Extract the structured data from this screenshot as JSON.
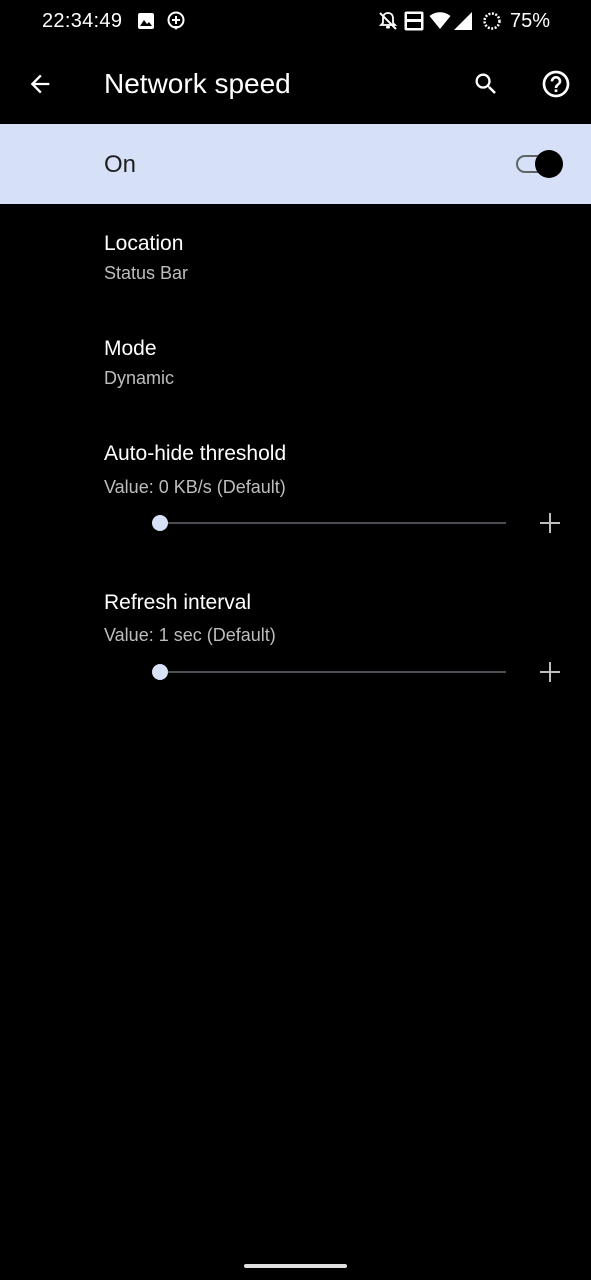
{
  "status_bar": {
    "time": "22:34:49",
    "battery_percent": "75%",
    "left_icons": [
      "image-icon",
      "location-plus-icon"
    ],
    "right_icons": [
      "notifications-off-icon",
      "volte-icon",
      "wifi-icon",
      "signal-icon",
      "battery-saver-ring-icon"
    ]
  },
  "app_bar": {
    "title": "Network speed",
    "back_icon": "arrow-back-icon",
    "actions": [
      "search-icon",
      "help-icon"
    ]
  },
  "master_switch": {
    "label": "On",
    "checked": true,
    "background": "#d6e0f7"
  },
  "preferences": {
    "location": {
      "title": "Location",
      "summary": "Status Bar"
    },
    "mode": {
      "title": "Mode",
      "summary": "Dynamic"
    },
    "auto_hide": {
      "title": "Auto-hide threshold",
      "summary": "Value: 0 KB/s (Default)",
      "slider_fraction": 0
    },
    "refresh": {
      "title": "Refresh interval",
      "summary": "Value: 1 sec (Default)",
      "slider_fraction": 0
    }
  },
  "colors": {
    "accent": "#d6e0f7",
    "background": "#000000",
    "text_primary": "#ffffff",
    "text_secondary": "#bdbdbd"
  }
}
